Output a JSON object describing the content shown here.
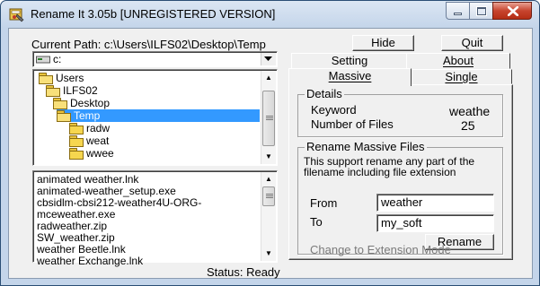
{
  "window": {
    "title": "Rename It 3.05b [UNREGISTERED VERSION]"
  },
  "path": {
    "label": "Current Path: c:\\Users\\ILFS02\\Desktop\\Temp"
  },
  "buttons": {
    "hide": "Hide",
    "quit": "Quit",
    "rename": "Rename"
  },
  "drive": {
    "selected": "c:"
  },
  "tabs": {
    "setting": "Setting",
    "about": "About",
    "massive": "Massive",
    "single": "Single"
  },
  "tree": {
    "items": [
      {
        "label": "Users"
      },
      {
        "label": "ILFS02"
      },
      {
        "label": "Desktop"
      },
      {
        "label": "Temp",
        "selected": true
      },
      {
        "label": "radw"
      },
      {
        "label": "weat"
      },
      {
        "label": "wwee"
      }
    ]
  },
  "files": {
    "items": [
      "animated weather.lnk",
      "animated-weather_setup.exe",
      "cbsidlm-cbsi212-weather4U-ORG-",
      "mceweather.exe",
      "radweather.zip",
      "SW_weather.zip",
      "weather Beetle.lnk",
      "weather Exchange.lnk"
    ]
  },
  "details": {
    "title": "Details",
    "keyword_label": "Keyword",
    "keyword_value": "weathe",
    "count_label": "Number of Files",
    "count_value": "25"
  },
  "massive": {
    "title": "Rename Massive Files",
    "description": "This support rename any part of the filename including file extension",
    "from_label": "From",
    "from_value": "weather",
    "to_label": "To",
    "to_value": "my_soft",
    "ext_mode": "Change to Extension Mode"
  },
  "status": {
    "text": "Status: Ready"
  }
}
